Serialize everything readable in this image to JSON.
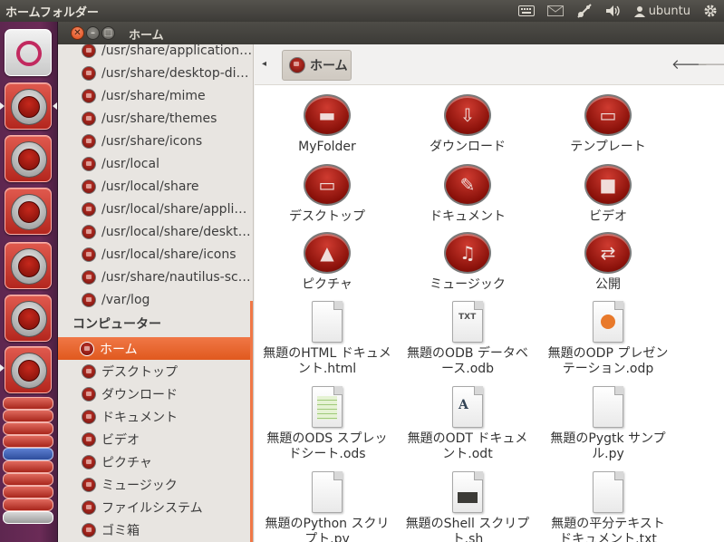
{
  "top_panel": {
    "title": "ホームフォルダー",
    "user": "ubuntu"
  },
  "window": {
    "title": "ホーム"
  },
  "sidebar": {
    "places": [
      "/usr/share/application…",
      "/usr/share/desktop-di…",
      "/usr/share/mime",
      "/usr/share/themes",
      "/usr/share/icons",
      "/usr/local",
      "/usr/local/share",
      "/usr/local/share/appli…",
      "/usr/local/share/deskt…",
      "/usr/local/share/icons",
      "/usr/share/nautilus-sc…",
      "/var/log"
    ],
    "computer_header": "コンピューター",
    "computer": [
      "ホーム",
      "デスクトップ",
      "ダウンロード",
      "ドキュメント",
      "ビデオ",
      "ピクチャ",
      "ミュージック",
      "ファイルシステム",
      "ゴミ箱"
    ]
  },
  "toolbar": {
    "crumb": "ホーム"
  },
  "files": {
    "folders": [
      {
        "label": "MyFolder",
        "icon": "folder-icon"
      },
      {
        "label": "ダウンロード",
        "icon": "download-icon"
      },
      {
        "label": "テンプレート",
        "icon": "template-icon"
      },
      {
        "label": "デスクトップ",
        "icon": "desktop-icon"
      },
      {
        "label": "ドキュメント",
        "icon": "document-icon"
      },
      {
        "label": "ビデオ",
        "icon": "video-icon"
      },
      {
        "label": "ピクチャ",
        "icon": "picture-icon"
      },
      {
        "label": "ミュージック",
        "icon": "music-icon"
      },
      {
        "label": "公開",
        "icon": "share-icon"
      }
    ],
    "docs": [
      {
        "line1": "無題のHTML ドキュメ",
        "line2": "ント.html",
        "mark": ""
      },
      {
        "line1": "無題のODB データベ",
        "line2": "ース.odb",
        "mark": "TXT"
      },
      {
        "line1": "無題のODP プレゼン",
        "line2": "テーション.odp",
        "mark": ""
      },
      {
        "line1": "無題のODS スプレッ",
        "line2": "ドシート.ods",
        "mark": ""
      },
      {
        "line1": "無題のODT ドキュメ",
        "line2": "ント.odt",
        "mark": "A"
      },
      {
        "line1": "無題のPygtk サンプ",
        "line2": "ル.py",
        "mark": ""
      },
      {
        "line1": "無題のPython スクリ",
        "line2": "プト.py",
        "mark": ""
      },
      {
        "line1": "無題のShell スクリプ",
        "line2": "ト.sh",
        "mark": ""
      },
      {
        "line1": "無題の平分テキスト",
        "line2": "ドキュメント.txt",
        "mark": ""
      }
    ]
  },
  "colors": {
    "accent": "#e0591e",
    "launcher": "#5e2750",
    "panel": "#3c3b37"
  }
}
